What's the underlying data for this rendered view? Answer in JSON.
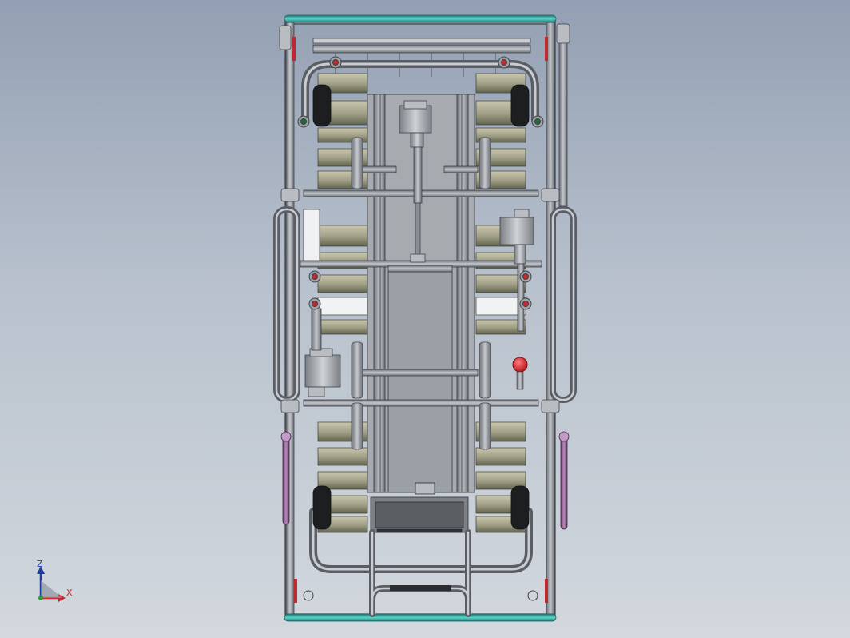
{
  "viewport": {
    "background_top": "#93a0b3",
    "background_bottom": "#d3d8de"
  },
  "model": {
    "frame_color": "#4a4d52",
    "tube_color": "#8a8e94",
    "tube_highlight": "#c9cdd3",
    "end_rail_color": "#2aa39c",
    "panel_color": "#b5b39a",
    "panel_shade": "#707562",
    "motor_color": "#9ea2a6",
    "accent_red": "#d21f26",
    "accent_green": "#1e6a3b",
    "side_handle_color": "#8a5d8f",
    "deck_color": "#a9adb2"
  },
  "triad": {
    "z_label": "Z",
    "x_label": "X",
    "z_color": "#1f3c9e",
    "x_color": "#d2232a",
    "y_color": "#2c9a3a"
  }
}
